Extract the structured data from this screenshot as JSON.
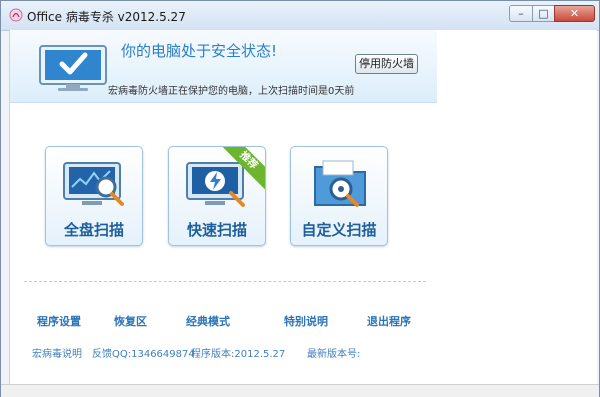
{
  "window": {
    "title": "Office 病毒专杀 v2012.5.27",
    "minimize_glyph": "–",
    "maximize_glyph": "□",
    "close_glyph": "✕"
  },
  "status": {
    "title": "你的电脑处于安全状态!",
    "description": "宏病毒防火墙正在保护您的电脑，上次扫描时间是0天前",
    "firewall_button": "停用防火墙"
  },
  "scans": [
    {
      "label": "全盘扫描",
      "icon": "full-scan-icon"
    },
    {
      "label": "快速扫描",
      "icon": "quick-scan-icon",
      "badge": "推荐"
    },
    {
      "label": "自定义扫描",
      "icon": "custom-scan-icon"
    }
  ],
  "links": [
    {
      "label": "程序设置"
    },
    {
      "label": "恢复区"
    },
    {
      "label": "经典模式"
    },
    {
      "label": "特别说明"
    },
    {
      "label": "退出程序"
    }
  ],
  "info": {
    "about": "宏病毒说明",
    "feedback": "反馈QQ:1346649874",
    "version": "程序版本:2012.5.27",
    "latest": "最新版本号:"
  },
  "colors": {
    "accent": "#2a7fc7",
    "link": "#2b74b8",
    "badge": "#6bb52f"
  }
}
